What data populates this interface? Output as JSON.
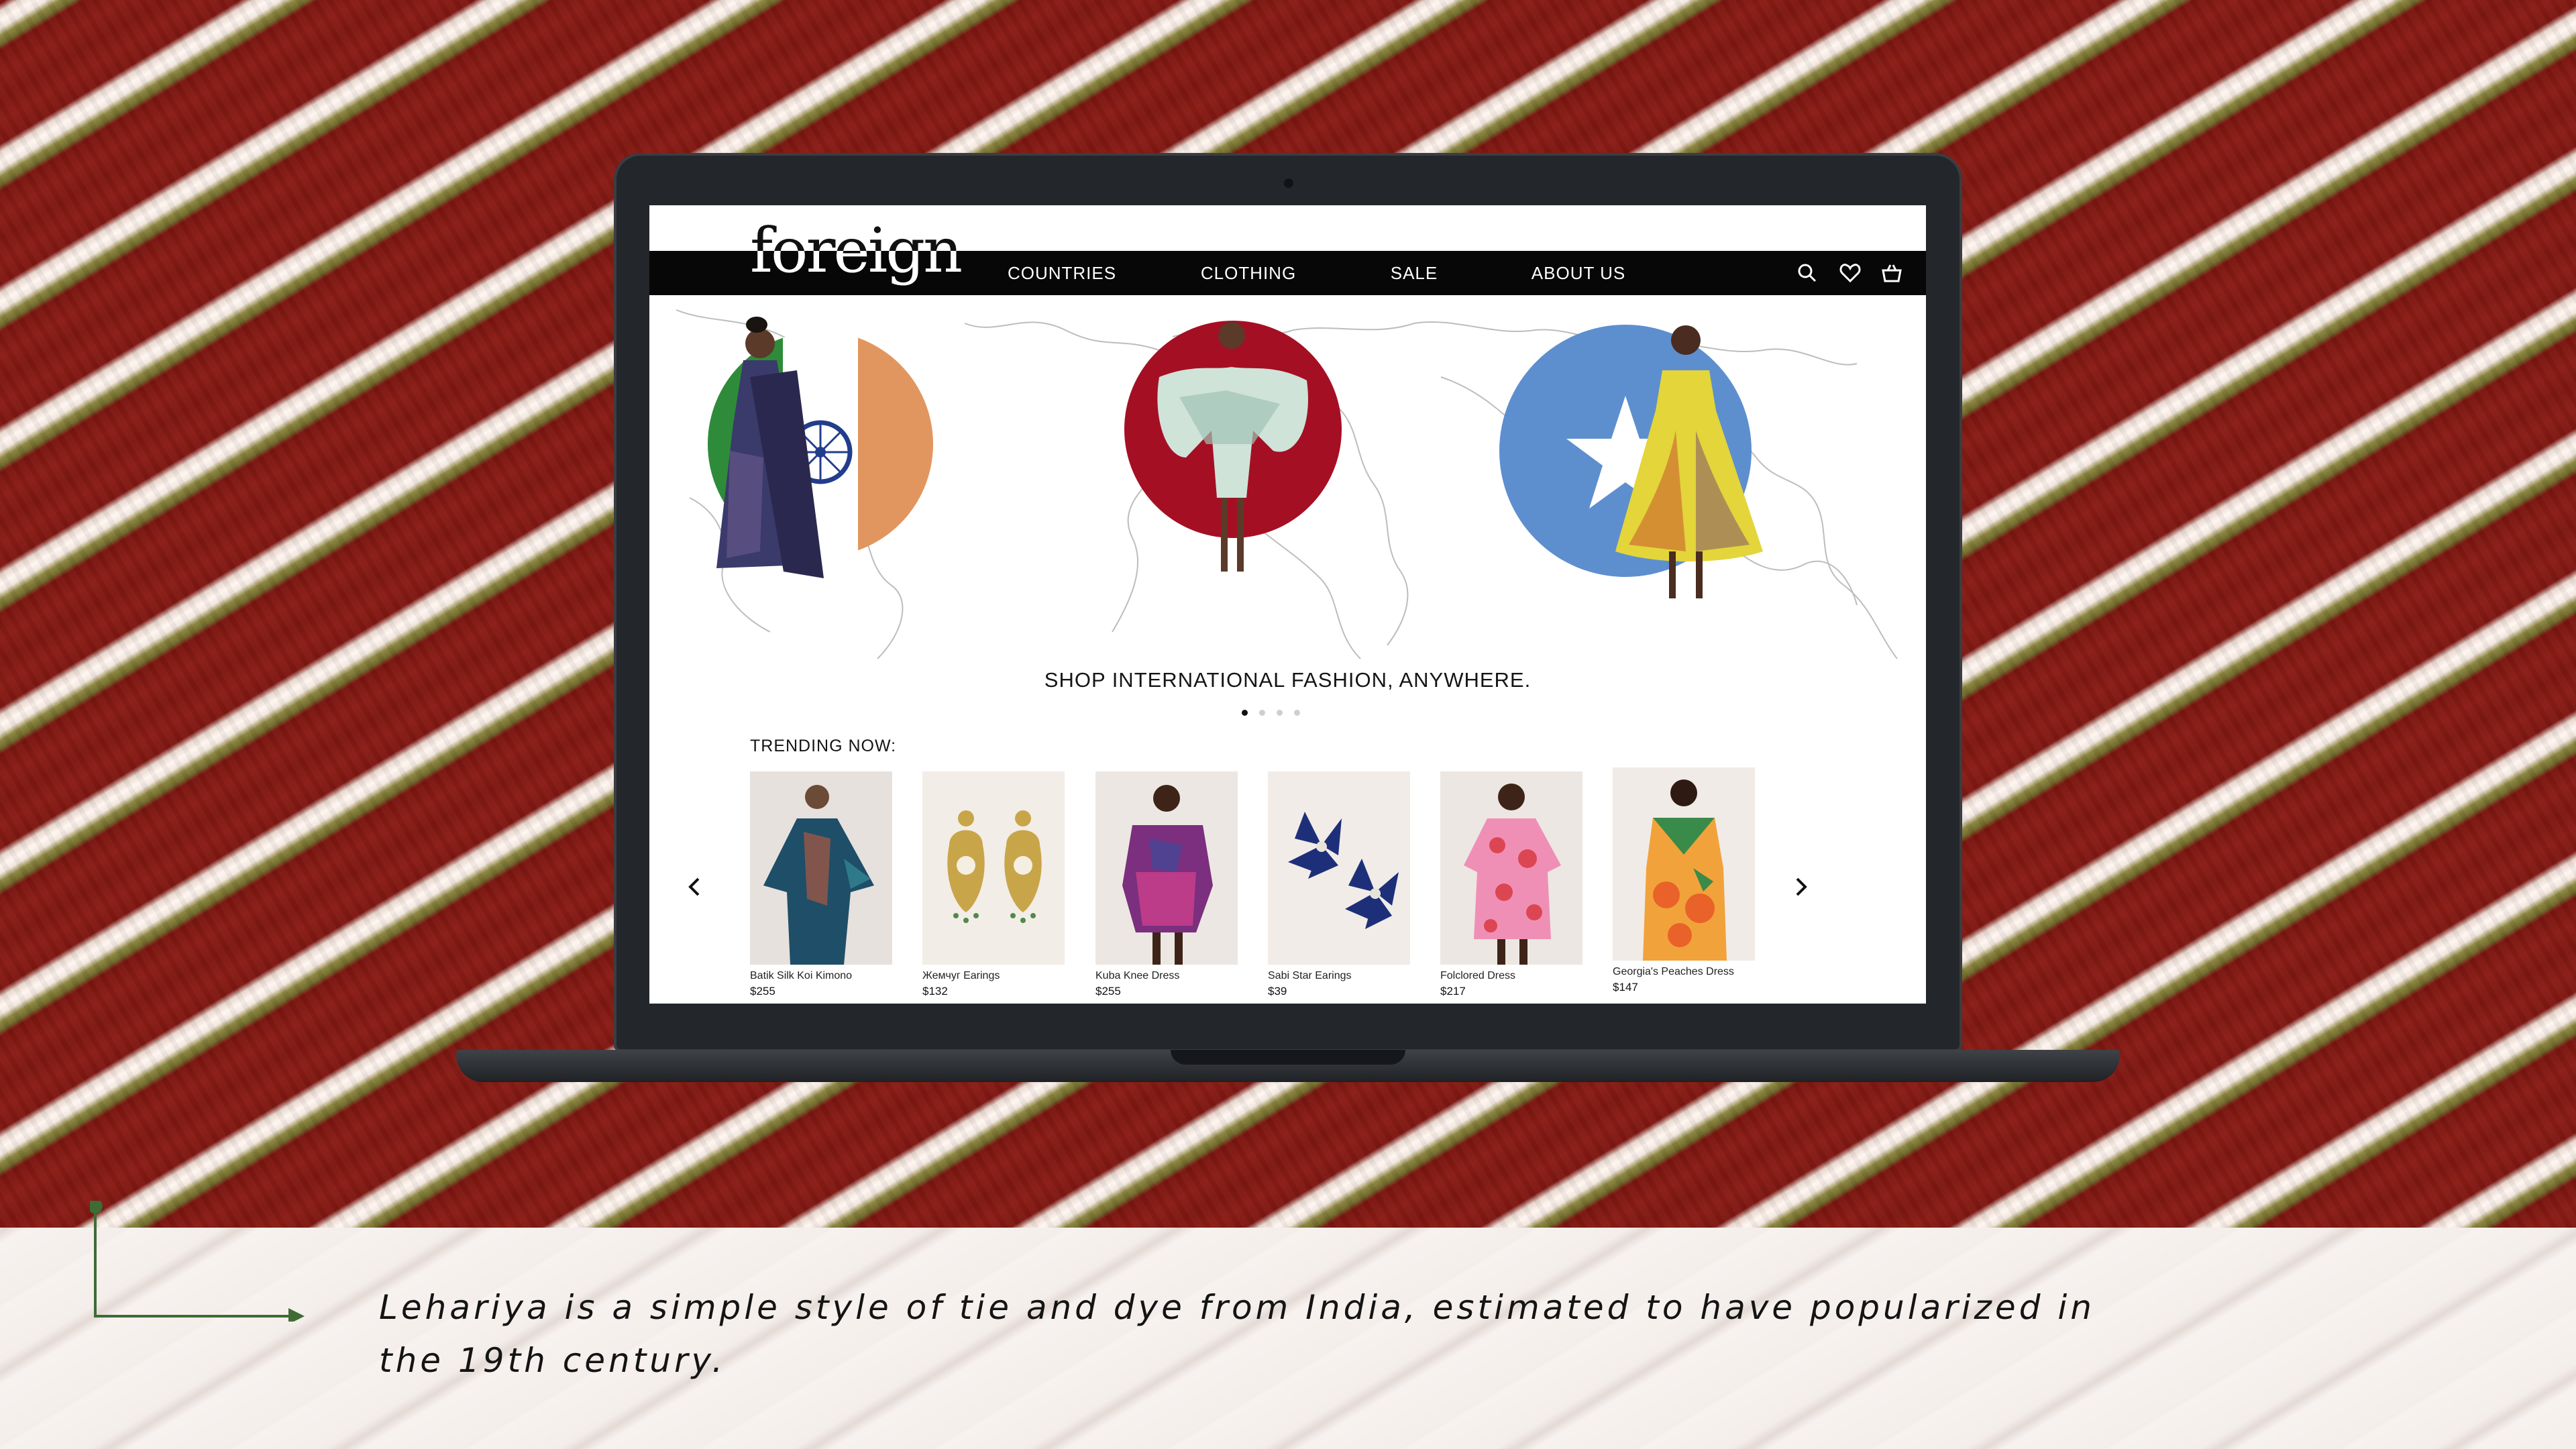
{
  "site": {
    "logo": "foreign",
    "nav": [
      "COUNTRIES",
      "CLOTHING",
      "SALE",
      "ABOUT US"
    ],
    "icons": [
      "search-icon",
      "heart-icon",
      "cart-icon"
    ]
  },
  "hero": {
    "title": "SHOP INTERNATIONAL FASHION, ANYWHERE.",
    "slides_total": 4,
    "active_slide": 1,
    "flags": [
      {
        "name": "india-flag",
        "colors": [
          "#2e8b3a",
          "#ffffff",
          "#e2965f",
          "#233d8c"
        ]
      },
      {
        "name": "red-circle",
        "colors": [
          "#a50f24"
        ]
      },
      {
        "name": "somalia-flag",
        "colors": [
          "#5d8fcf",
          "#ffffff"
        ]
      }
    ]
  },
  "trending": {
    "label": "TRENDING NOW:",
    "products": [
      {
        "name": "Batik Silk Koi Kimono",
        "price": "$255"
      },
      {
        "name": "Жемчуг Earings",
        "price": "$132"
      },
      {
        "name": "Kuba Knee Dress",
        "price": "$255"
      },
      {
        "name": "Sabi Star Earings",
        "price": "$39"
      },
      {
        "name": "Folclored Dress",
        "price": "$217"
      },
      {
        "name": "Georgia's Peaches Dress",
        "price": "$147"
      }
    ]
  },
  "caption": "Lehariya is a simple style of tie and dye from India, estimated to have popularized in the 19th century.",
  "colors": {
    "fabric_red": "#8a1a14",
    "accent_green": "#3f6b35",
    "nav_black": "#070707"
  }
}
